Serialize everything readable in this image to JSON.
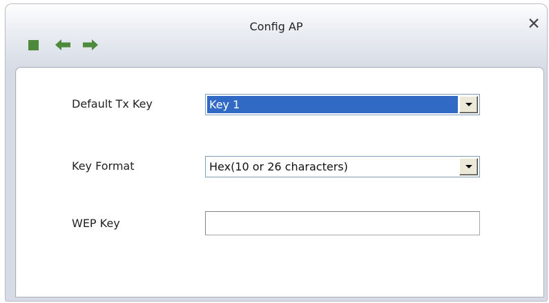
{
  "window": {
    "title": "Config AP",
    "close_symbol": "✕"
  },
  "toolbar": {
    "icons": [
      "stop-square-icon",
      "back-arrow-icon",
      "forward-arrow-icon"
    ],
    "icon_color": "#4d8a3c"
  },
  "form": {
    "default_tx_key": {
      "label": "Default Tx Key",
      "value": "Key 1"
    },
    "key_format": {
      "label": "Key Format",
      "value": "Hex(10 or 26 characters)"
    },
    "wep_key": {
      "label": "WEP Key",
      "value": ""
    }
  },
  "colors": {
    "selection": "#316ac5",
    "accent_green": "#4d8a3c"
  }
}
